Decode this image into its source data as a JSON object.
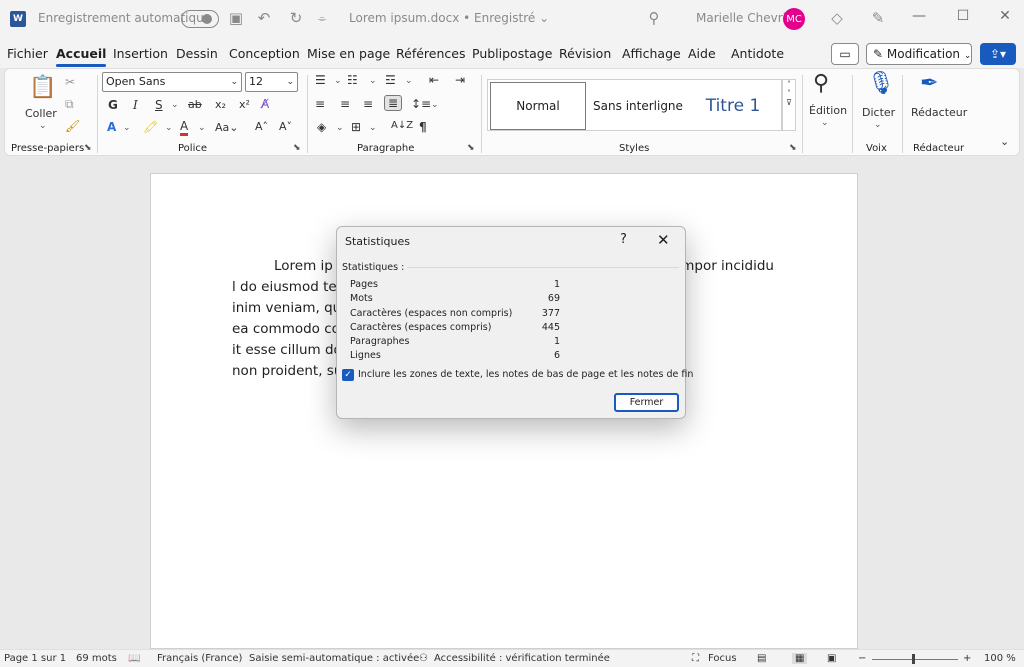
{
  "titlebar": {
    "app_logo": "W",
    "autosave_label": "Enregistrement automatique",
    "document_title": "Lorem ipsum.docx • Enregistré ⌄",
    "user_name": "Marielle Chevrier",
    "user_initials": "MC",
    "icons": [
      "save-icon",
      "undo-icon",
      "redo-icon",
      "customize-icon",
      "search-icon",
      "diamond-icon",
      "pen-icon",
      "minimize-icon",
      "maximize-icon",
      "close-icon"
    ]
  },
  "menu": {
    "tabs": [
      "Fichier",
      "Accueil",
      "Insertion",
      "Dessin",
      "Conception",
      "Mise en page",
      "Références",
      "Publipostage",
      "Révision",
      "Affichage",
      "Aide",
      "Antidote"
    ],
    "active": "Accueil",
    "modification_label": "Modification",
    "modification_caret": "⌄"
  },
  "ribbon": {
    "clipboard": {
      "paste_label": "Coller",
      "group_label": "Presse-papiers"
    },
    "font": {
      "font_name": "Open Sans",
      "font_size": "12",
      "group_label": "Police"
    },
    "paragraph": {
      "group_label": "Paragraphe"
    },
    "styles": {
      "items": [
        "Normal",
        "Sans interligne",
        "Titre 1"
      ],
      "group_label": "Styles"
    },
    "editing": {
      "label": "Édition"
    },
    "voice": {
      "dictate_label": "Dicter",
      "group_label": "Voix"
    },
    "editor": {
      "label": "Rédacteur",
      "group_label": "Rédacteur"
    }
  },
  "document": {
    "paragraph_parts": [
      "Lorem ip",
      "l do eiusmod tempor incididu",
      "inim veniam, quis nostrud",
      "ea commodo consequat. Dui",
      "it esse cillum dolore eu fugia",
      "non proident, sunt in culpa qu"
    ]
  },
  "dialog": {
    "title": "Statistiques",
    "help": "?",
    "close": "✕",
    "section_label": "Statistiques :",
    "stats": [
      {
        "label": "Pages",
        "value": "1"
      },
      {
        "label": "Mots",
        "value": "69"
      },
      {
        "label": "Caractères (espaces non compris)",
        "value": "377"
      },
      {
        "label": "Caractères (espaces compris)",
        "value": "445"
      },
      {
        "label": "Paragraphes",
        "value": "1"
      },
      {
        "label": "Lignes",
        "value": "6"
      }
    ],
    "checkbox_label": "Inclure les zones de texte, les notes de bas de page et les notes de fin",
    "checkbox_checked": true,
    "close_button": "Fermer"
  },
  "statusbar": {
    "page": "Page 1 sur 1",
    "words": "69 mots",
    "language": "Français (France)",
    "autocomplete": "Saisie semi-automatique : activée",
    "accessibility": "Accessibilité : vérification terminée",
    "focus": "Focus",
    "zoom_minus": "−",
    "zoom_plus": "+",
    "zoom": "100 %"
  },
  "colors": {
    "accent": "#185abd",
    "avatar": "#e3008c",
    "word_blue": "#2b579a"
  }
}
